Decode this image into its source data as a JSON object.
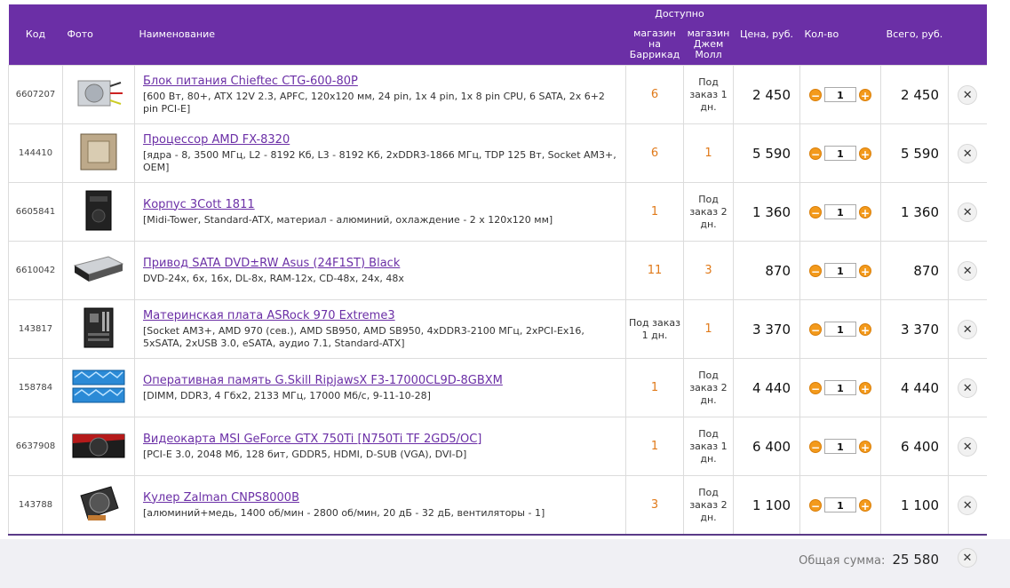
{
  "header": {
    "code": "Код",
    "photo": "Фото",
    "name": "Наименование",
    "available": "Доступно",
    "store1": "магазин на Баррикад",
    "store2": "магазин Джем Молл",
    "price": "Цена, руб.",
    "qty": "Кол-во",
    "total": "Всего, руб."
  },
  "rows": [
    {
      "code": "6607207",
      "title": "Блок питания Chieftec CTG-600-80P",
      "desc": "[600 Вт, 80+, ATX 12V 2.3, APFC, 120x120 мм, 24 pin, 1x 4 pin, 1x 8 pin CPU, 6 SATA, 2x 6+2 pin PCI-E]",
      "s1": "6",
      "s2": "Под заказ 1 дн.",
      "price": "2 450",
      "qty": "1",
      "total": "2 450",
      "thumb": "psu"
    },
    {
      "code": "144410",
      "title": "Процессор AMD FX-8320",
      "desc": "[ядра - 8, 3500 МГц, L2 - 8192 Кб, L3 - 8192 Кб, 2xDDR3-1866 МГц, TDP 125 Вт, Socket AM3+, OEM]",
      "s1": "6",
      "s2": "1",
      "price": "5 590",
      "qty": "1",
      "total": "5 590",
      "thumb": "cpu"
    },
    {
      "code": "6605841",
      "title": "Корпус 3Cott 1811",
      "desc": "[Midi-Tower, Standard-ATX, материал - алюминий, охлаждение - 2 x 120x120 мм]",
      "s1": "1",
      "s2": "Под заказ 2 дн.",
      "price": "1 360",
      "qty": "1",
      "total": "1 360",
      "thumb": "case"
    },
    {
      "code": "6610042",
      "title": "Привод SATA DVD±RW Asus (24F1ST) Black",
      "desc": "DVD-24x, 6x, 16x, DL-8x, RAM-12x, CD-48x, 24x, 48x",
      "s1": "11",
      "s2": "3",
      "price": "870",
      "qty": "1",
      "total": "870",
      "thumb": "dvd"
    },
    {
      "code": "143817",
      "title": "Материнская плата ASRock 970 Extreme3",
      "desc": "[Socket AM3+, AMD 970 (сев.), AMD SB950, AMD SB950, 4xDDR3-2100 МГц, 2xPCI-Ex16, 5xSATA, 2xUSB 3.0, eSATA, аудио 7.1, Standard-ATX]",
      "s1": "Под заказ 1 дн.",
      "s2": "1",
      "price": "3 370",
      "qty": "1",
      "total": "3 370",
      "thumb": "mb"
    },
    {
      "code": "158784",
      "title": "Оперативная память G.Skill RipjawsX F3-17000CL9D-8GBXM",
      "desc": "[DIMM, DDR3, 4 Гбx2, 2133 МГц, 17000 Мб/с, 9-11-10-28]",
      "s1": "1",
      "s2": "Под заказ 2 дн.",
      "price": "4 440",
      "qty": "1",
      "total": "4 440",
      "thumb": "ram"
    },
    {
      "code": "6637908",
      "title": "Видеокарта MSI GeForce GTX 750Ti [N750Ti TF 2GD5/OC]",
      "desc": "[PCI-E 3.0, 2048 Мб, 128 бит, GDDR5, HDMI, D-SUB (VGA), DVI-D]",
      "s1": "1",
      "s2": "Под заказ 1 дн.",
      "price": "6 400",
      "qty": "1",
      "total": "6 400",
      "thumb": "gpu"
    },
    {
      "code": "143788",
      "title": "Кулер Zalman CNPS8000B",
      "desc": "[алюминий+медь, 1400 об/мин - 2800 об/мин, 20 дБ - 32 дБ, вентиляторы - 1]",
      "s1": "3",
      "s2": "Под заказ 2 дн.",
      "price": "1 100",
      "qty": "1",
      "total": "1 100",
      "thumb": "cooler"
    }
  ],
  "footer": {
    "label": "Общая сумма:",
    "sum": "25 580"
  },
  "colors": {
    "header_bg": "#6b2fa6",
    "link": "#6b2fa6",
    "stock_number": "#e07a1a",
    "qty_button": "#f39a1c"
  }
}
